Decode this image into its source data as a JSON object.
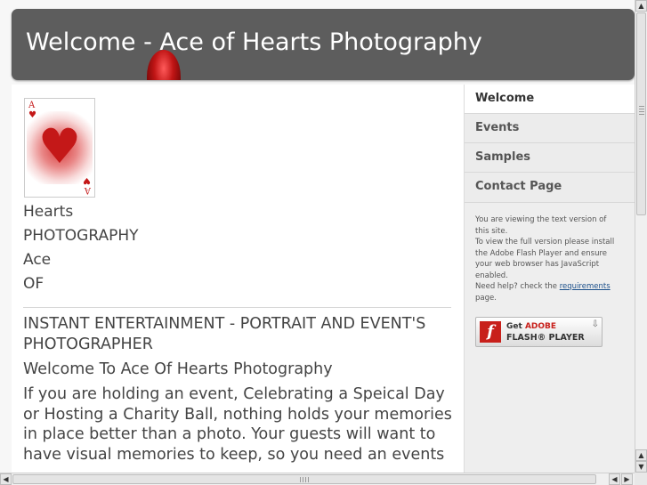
{
  "header": {
    "title": "Welcome - Ace of Hearts Photography"
  },
  "logo": {
    "card_rank": "A",
    "suit_symbol": "♥",
    "suit_color": "#c41818",
    "lines": [
      "Hearts",
      "PHOTOGRAPHY",
      "Ace",
      "OF"
    ]
  },
  "main": {
    "heading": "INSTANT ENTERTAINMENT - PORTRAIT AND EVENT'S PHOTOGRAPHER",
    "subheading": "Welcome To Ace Of Hearts Photography",
    "paragraph": "If you are holding an event, Celebrating a Speical Day or Hosting a Charity Ball, nothing holds your memories in place better than a photo. Your guests will want to have visual memories to keep, so you need an events"
  },
  "nav": {
    "items": [
      {
        "label": "Welcome",
        "active": true
      },
      {
        "label": "Events",
        "active": false
      },
      {
        "label": "Samples",
        "active": false
      },
      {
        "label": "Contact Page",
        "active": false
      }
    ]
  },
  "notice": {
    "line1": "You are viewing the text version of this site.",
    "line2": "To view the full version please install the Adobe Flash Player and ensure your web browser has JavaScript enabled.",
    "help_prefix": "Need help? check the ",
    "help_link": "requirements",
    "help_suffix": "page."
  },
  "flash_badge": {
    "logo_letter": "f",
    "get": "Get",
    "adobe": "ADOBE",
    "player": "FLASH® PLAYER",
    "download_icon": "download-arrow-icon"
  },
  "scrollbars": {
    "up_arrow": "▲",
    "down_arrow": "▼",
    "left_arrow": "◀",
    "right_arrow": "▶"
  },
  "colors": {
    "header_bg": "#5d5d5d",
    "accent_red": "#c8201b",
    "link": "#1b4f8a"
  }
}
